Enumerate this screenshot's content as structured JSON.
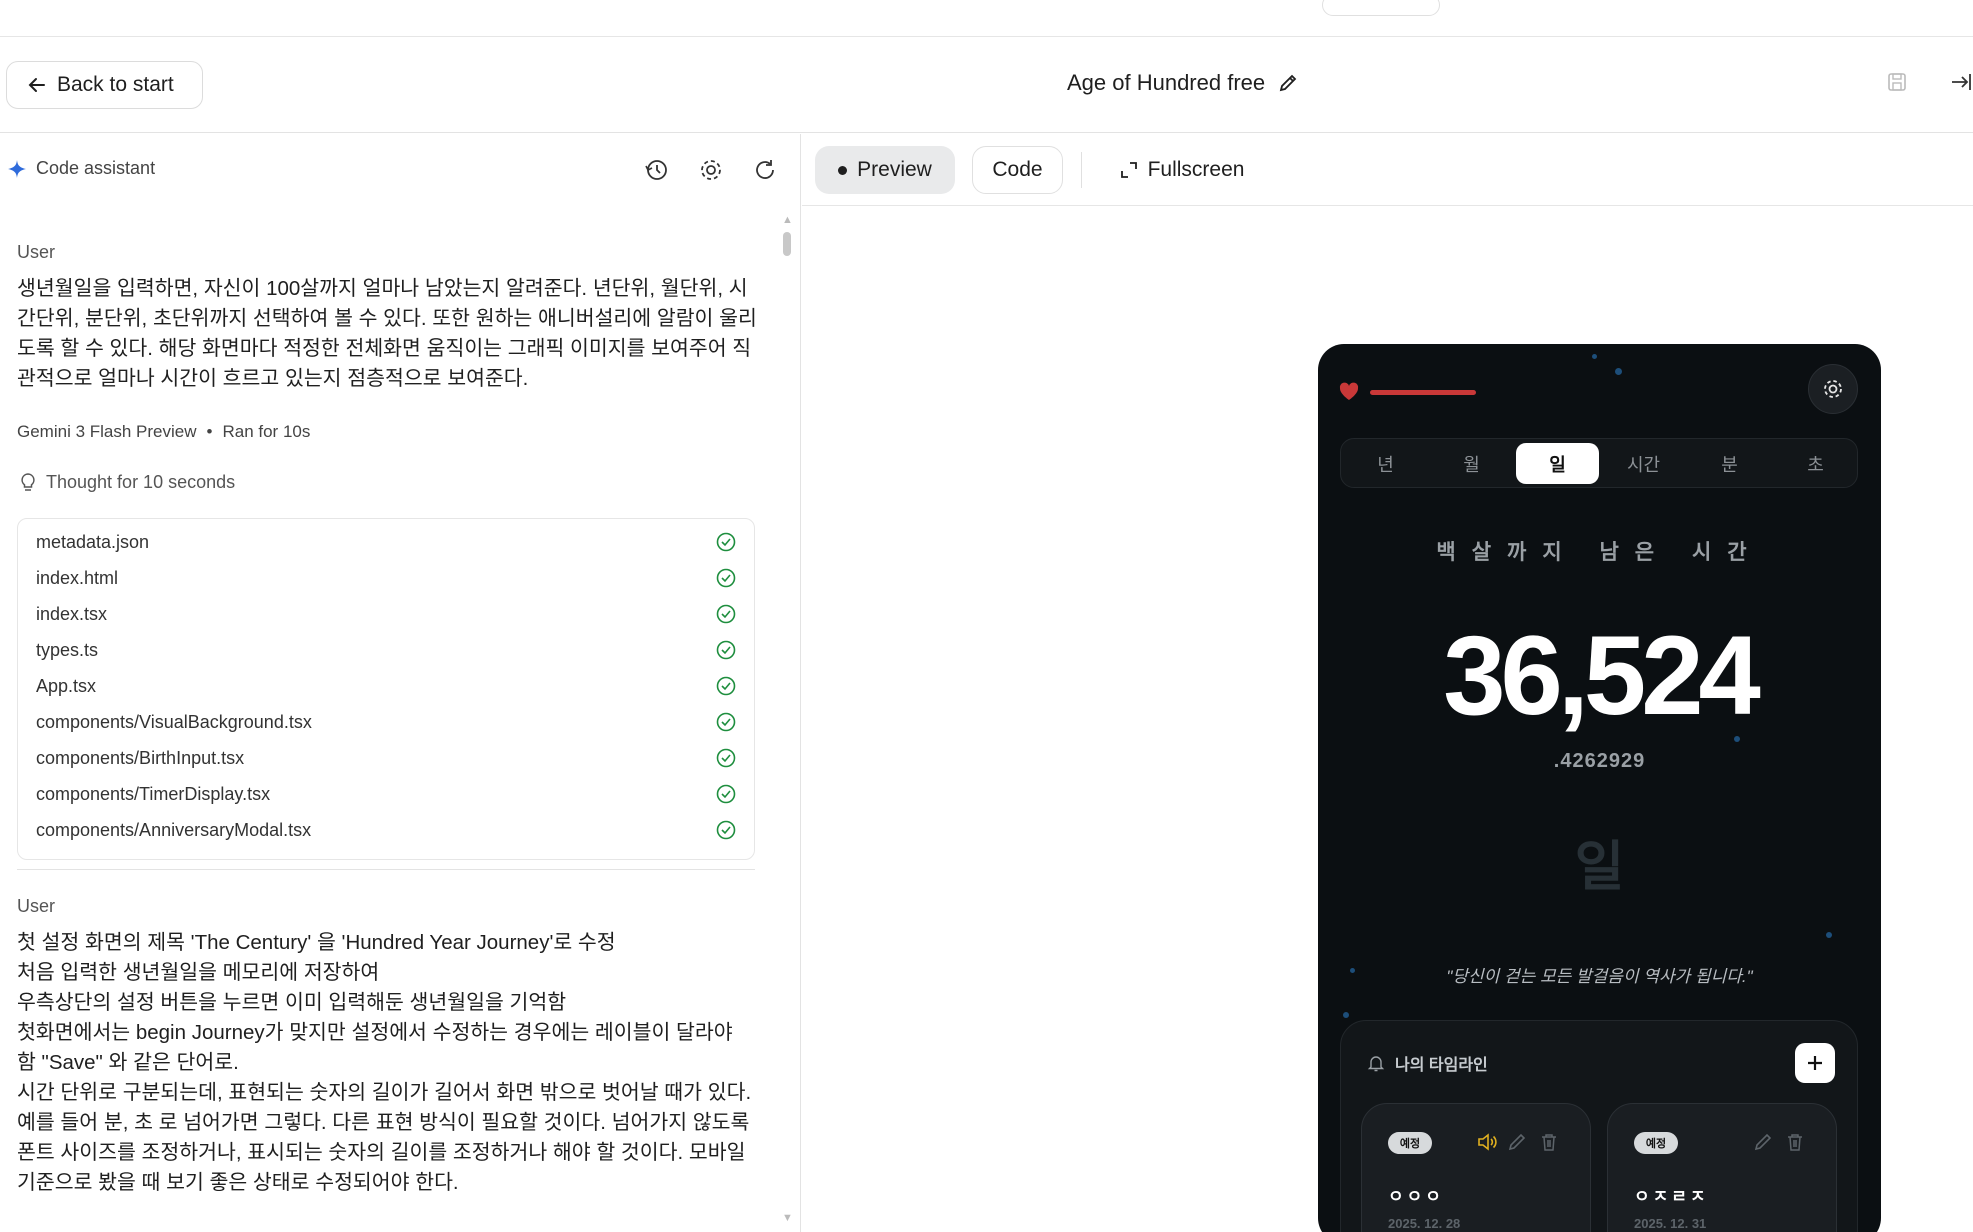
{
  "header": {
    "back_label": "Back to start",
    "title": "Age of Hundred free"
  },
  "assistant": {
    "label": "Code assistant",
    "messages": [
      {
        "role": "User",
        "text": "생년월일을 입력하면, 자신이 100살까지 얼마나 남았는지 알려준다. 년단위, 월단위, 시간단위, 분단위, 초단위까지 선택하여 볼 수 있다. 또한 원하는 애니버설리에 알람이 울리도록 할 수 있다. 해당 화면마다 적정한 전체화면 움직이는 그래픽 이미지를 보여주어 직관적으로 얼마나 시간이 흐르고 있는지 점층적으로 보여준다."
      },
      {
        "role": "User",
        "lines": [
          "첫 설정 화면의 제목 'The Century' 을 'Hundred Year Journey'로 수정",
          "처음 입력한 생년월일을 메모리에 저장하여",
          "우측상단의 설정 버튼을 누르면 이미 입력해둔 생년월일을 기억함",
          "첫화면에서는 begin Journey가 맞지만 설정에서 수정하는 경우에는 레이블이 달라야 함 \"Save\" 와 같은 단어로.",
          "시간 단위로 구분되는데, 표현되는 숫자의 길이가 길어서 화면 밖으로 벗어날 때가 있다. 예를 들어 분, 초 로 넘어가면 그렇다. 다른 표현 방식이 필요할 것이다. 넘어가지 않도록 폰트 사이즈를 조정하거나, 표시되는 숫자의 길이를 조정하거나 해야 할 것이다. 모바일 기준으로 봤을 때 보기 좋은 상태로 수정되어야 한다."
        ]
      }
    ],
    "model": "Gemini 3 Flash Preview",
    "run_time": "Ran for 10s",
    "thought": "Thought for 10 seconds",
    "files": [
      "metadata.json",
      "index.html",
      "index.tsx",
      "types.ts",
      "App.tsx",
      "components/VisualBackground.tsx",
      "components/BirthInput.tsx",
      "components/TimerDisplay.tsx",
      "components/AnniversaryModal.tsx"
    ]
  },
  "preview_tabs": {
    "preview": "Preview",
    "code": "Code",
    "fullscreen": "Fullscreen"
  },
  "app": {
    "units": [
      "년",
      "월",
      "일",
      "시간",
      "분",
      "초"
    ],
    "active_unit": "일",
    "remaining_label": "백살까지 남은 시간",
    "big_number": "36,524",
    "decimal": ".4262929",
    "unit_display": "일",
    "quote": "\"당신이 걷는 모든 발걸음이 역사가 됩니다.\"",
    "timeline_title": "나의 타임라인",
    "cards": [
      {
        "badge": "예정",
        "name": "ㅇㅇㅇ",
        "date": "2025. 12. 28",
        "has_sound": true
      },
      {
        "badge": "예정",
        "name": "ㅇㅈㄹㅈ",
        "date": "2025. 12. 31",
        "has_sound": false
      }
    ],
    "colors": {
      "accent_red": "#c93838",
      "bg": "#0b0f12"
    }
  }
}
